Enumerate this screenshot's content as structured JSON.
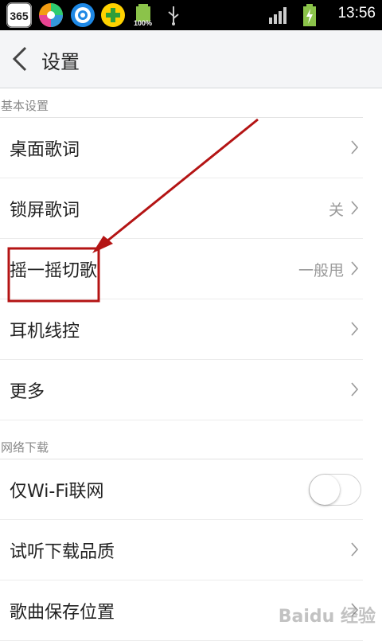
{
  "status_bar": {
    "battery_label": "100%",
    "time": "13:56",
    "app_icons": [
      "365-icon",
      "color-wheel-icon",
      "target-icon",
      "plus-icon"
    ]
  },
  "header": {
    "title": "设置"
  },
  "sections": [
    {
      "title": "基本设置"
    },
    {
      "title": "网络下载"
    }
  ],
  "rows": [
    {
      "label": "桌面歌词",
      "value": ""
    },
    {
      "label": "锁屏歌词",
      "value": "关"
    },
    {
      "label": "摇一摇切歌",
      "value": "一般甩"
    },
    {
      "label": "耳机线控",
      "value": ""
    },
    {
      "label": "更多",
      "value": ""
    },
    {
      "label": "仅Wi-Fi联网",
      "toggle": false
    },
    {
      "label": "试听下载品质",
      "value": ""
    },
    {
      "label": "歌曲保存位置",
      "value": ""
    }
  ],
  "watermark": "Baidu 经验",
  "colors": {
    "annotation": "#b41414",
    "section_text": "#888888"
  }
}
